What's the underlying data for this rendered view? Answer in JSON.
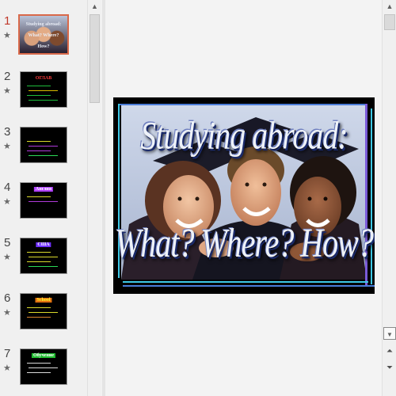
{
  "thumbnails": [
    {
      "number": "1",
      "title": "Studying abroad: What? Where? How?",
      "active": true,
      "title_color": "#e8ecf5",
      "title_bg": "transparent",
      "lines": []
    },
    {
      "number": "2",
      "title": "ОГЛАВ",
      "active": false,
      "title_color": "#ff3b3b",
      "title_bg": "transparent",
      "lines": [
        "#22dd44",
        "#ffdd00",
        "#22dd44",
        "#22dd44"
      ]
    },
    {
      "number": "3",
      "title": "",
      "active": false,
      "title_color": "#ffff33",
      "title_bg": "transparent",
      "lines": [
        "#ffff33",
        "#cc44ff",
        "#cc44ff",
        "#33ff66"
      ]
    },
    {
      "number": "4",
      "title": "Англия",
      "active": false,
      "title_color": "#ffffff",
      "title_bg": "#b040ff",
      "lines": [
        "#ffff33",
        "#cc44ff"
      ]
    },
    {
      "number": "5",
      "title": "США",
      "active": false,
      "title_color": "#ffffff",
      "title_bg": "#7030ff",
      "lines": [
        "#ffff33",
        "#ffff33",
        "#ffff33",
        "#33ff66"
      ]
    },
    {
      "number": "6",
      "title": "School",
      "active": false,
      "title_color": "#ffff33",
      "title_bg": "#e07010",
      "lines": [
        "#ffff33",
        "#ffff33",
        "#ff9933"
      ]
    },
    {
      "number": "7",
      "title": "Обучение",
      "active": false,
      "title_color": "#ffffff",
      "title_bg": "#20bb30",
      "lines": [
        "#ffffff",
        "#ffffff",
        "#ffffff"
      ]
    }
  ],
  "slide": {
    "title": "Studying abroad:",
    "subtitle": "What? Where? How?"
  },
  "icons": {
    "star": "★",
    "up": "▲",
    "down": "▼",
    "prev_slide": "⏶",
    "next_slide": "⏷"
  },
  "colors": {
    "active_border": "#d9694a",
    "frame_blue": "#4a7cd8",
    "frame_cyan": "#3ec9e6",
    "frame_purple": "#7a5bd8"
  }
}
